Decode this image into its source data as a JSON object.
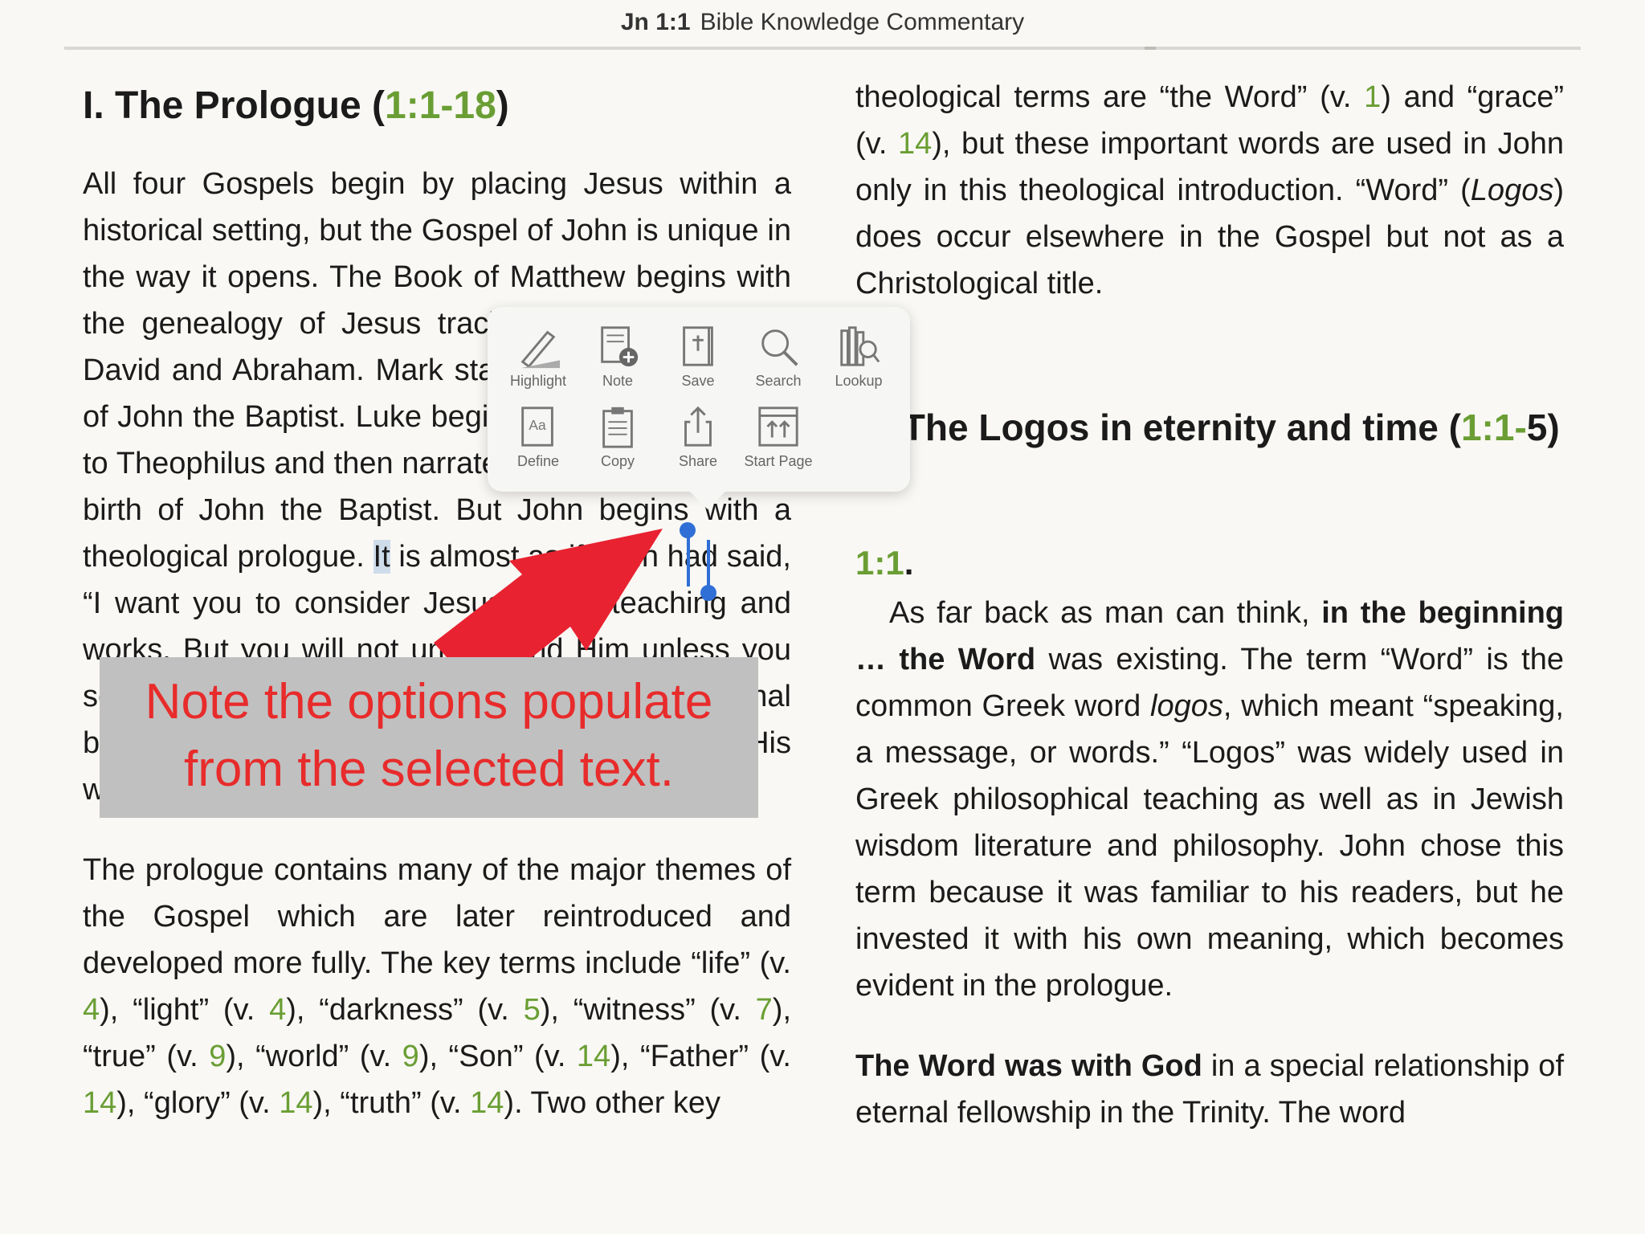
{
  "header": {
    "ref": "Jn 1:1",
    "book": "Bible Knowledge Commentary"
  },
  "left": {
    "title_pre": "I. The Prologue (",
    "title_ref": "1:1-18",
    "title_post": ")",
    "p1": "All four Gospels begin by placing Jesus within a historical setting, but the Gospel of John is unique in the way it opens. The Book of Matthew begins with the genealogy of Jesus tracing His descent from David and Abraham. Mark starts with the beginning of John the Baptist. Luke begins dedicating his work to Theophilus and then narrates the prediction of the birth of John the Baptist. But John begins with a theological prologue.",
    "p1_sel": "It",
    "p1_tail": " is almost as if John had said, “I want you to consider Jesus in His teaching and works. But you will not understand Him unless you see that His deepest secrets come from His eternal being in the Trinity. Jesus is the eternal God and His words and deeds are those of the God-Man.”",
    "p2_a": "The prologue contains many of the major themes of the Gospel which are later reintroduced and developed more fully. The key terms include “life” (v. ",
    "p2_v1": "4",
    "p2_b": "), “light” (v. ",
    "p2_v2": "4",
    "p2_c": "), “darkness” (v. ",
    "p2_v3": "5",
    "p2_d": "), “witness” (v. ",
    "p2_v4": "7",
    "p2_e": "), “true” (v. ",
    "p2_v5": "9",
    "p2_f": "), “world” (v. ",
    "p2_v6": "9",
    "p2_g": "), “Son” (v. ",
    "p2_v7": "14",
    "p2_h": "), “Father” (v. ",
    "p2_v8": "14",
    "p2_i": "), “glory” (v. ",
    "p2_v9": "14",
    "p2_j": "), “truth” (v. ",
    "p2_v10": "14",
    "p2_k": "). Two other key"
  },
  "right": {
    "p0_a": "theological terms are “the Word” (v. ",
    "p0_v1": "1",
    "p0_b": ") and “grace” (v. ",
    "p0_v2": "14",
    "p0_c": "), but these important words are used in John only in this theological introduction. “Word” (",
    "p0_logos": "Logos",
    "p0_d": ") does occur elsewhere in the Gospel but not as a Christological title.",
    "sec_pre": "A. The Logos in eternity and time (",
    "sec_ref": "1:1-",
    "sec_tail": "5)",
    "verse": "1:1",
    "verse_dot": ".",
    "p1_a": "As far back as man can think, ",
    "p1_b1": "in the beginning … the Word",
    "p1_c": " was existing. The term “Word” is the common Greek word ",
    "p1_logos": "logos",
    "p1_d": ", which meant “speaking, a message, or words.” “Logos” was widely used in Greek philosophical teaching as well as in Jewish wisdom literature and philosophy. John chose this term because it was familiar to his readers, but he invested it with his own meaning, which becomes evident in the prologue.",
    "p2_b": "The Word was with God",
    "p2_rest": " in a special relationship of eternal fellowship in the Trinity. The word"
  },
  "popup": {
    "highlight": "Highlight",
    "note": "Note",
    "save": "Save",
    "search": "Search",
    "lookup": "Lookup",
    "define": "Define",
    "copy": "Copy",
    "share": "Share",
    "start_page": "Start Page"
  },
  "callout": {
    "line1": "Note the options populate",
    "line2": "from the selected text."
  },
  "colors": {
    "accent_green": "#6a9e34",
    "selection_blue": "#2f6fd6",
    "arrow_red": "#e82230",
    "callout_bg": "#c0c0c0"
  }
}
